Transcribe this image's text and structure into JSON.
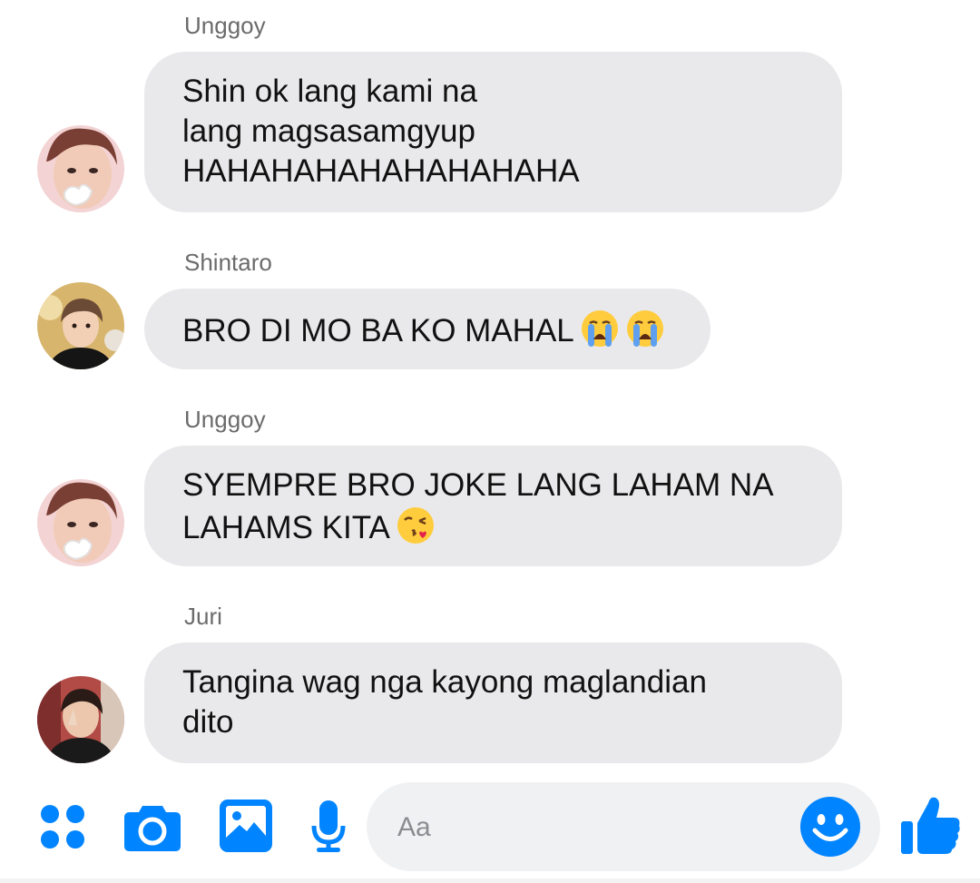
{
  "colors": {
    "accent": "#0084ff",
    "bubble": "#e9e9eb",
    "sender_name": "#6b6b6b",
    "input_bg": "#f0f1f3"
  },
  "messages": [
    {
      "sender": "Unggoy",
      "avatar": "avatar-unggoy",
      "lines": [
        "Shin ok lang kami na",
        "lang magsasamgyup",
        "HAHAHAHAHAHAHAHAHA"
      ],
      "emoji": []
    },
    {
      "sender": "Shintaro",
      "avatar": "avatar-shintaro",
      "lines": [
        "BRO DI MO BA KO MAHAL"
      ],
      "emoji": [
        "loudly-crying-face-emoji",
        "loudly-crying-face-emoji"
      ]
    },
    {
      "sender": "Unggoy",
      "avatar": "avatar-unggoy",
      "lines": [
        "SYEMPRE BRO JOKE LANG LAHAM NA",
        "LAHAMS KITA"
      ],
      "emoji": [
        "face-blowing-kiss-emoji"
      ]
    },
    {
      "sender": "Juri",
      "avatar": "avatar-juri",
      "lines": [
        "Tangina wag nga kayong maglandian",
        "dito"
      ],
      "emoji": []
    }
  ],
  "composer": {
    "placeholder": "Aa",
    "icons": [
      "more-apps-icon",
      "camera-icon",
      "gallery-icon",
      "microphone-icon",
      "emoji-icon",
      "thumbs-up-icon"
    ]
  }
}
